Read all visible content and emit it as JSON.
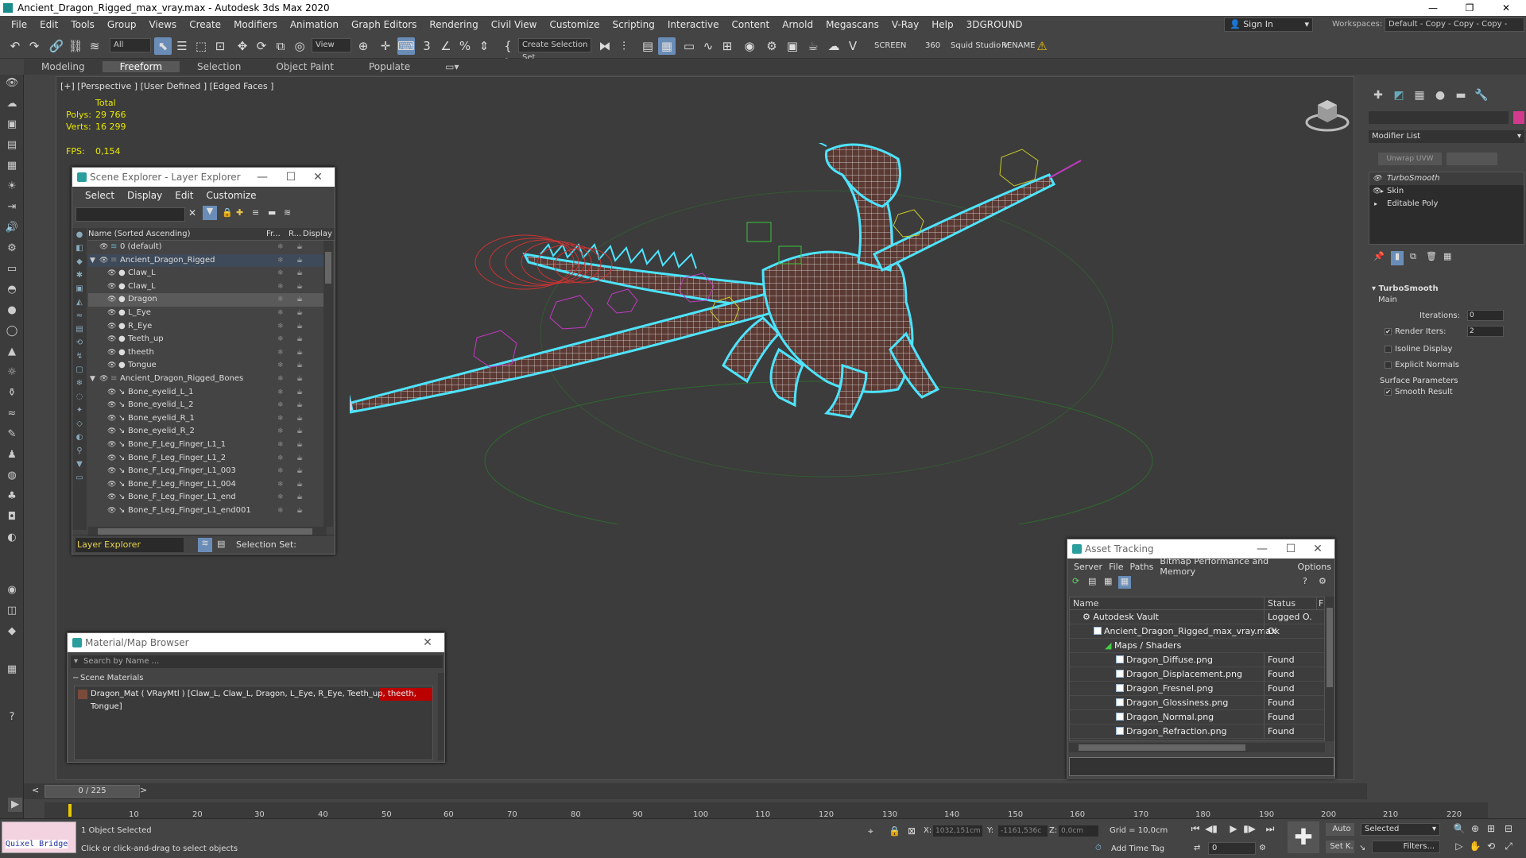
{
  "window": {
    "title": "Ancient_Dragon_Rigged_max_vray.max - Autodesk 3ds Max 2020"
  },
  "menu": [
    "File",
    "Edit",
    "Tools",
    "Group",
    "Views",
    "Create",
    "Modifiers",
    "Animation",
    "Graph Editors",
    "Rendering",
    "Civil View",
    "Customize",
    "Scripting",
    "Interactive",
    "Content",
    "Arnold",
    "Megascans",
    "V-Ray",
    "Help",
    "3DGROUND"
  ],
  "account": {
    "signin": "Sign In",
    "workspaces_label": "Workspaces:",
    "workspace": "Default - Copy - Copy - Copy - Copy"
  },
  "toolbar": {
    "filter": "All",
    "ref_coord": "View",
    "selection_set": "Create Selection Set",
    "screen": "SCREEN",
    "angle": "360",
    "squid": "Squid Studio v",
    "rename": "RENAME"
  },
  "ribbon": [
    "Modeling",
    "Freeform",
    "Selection",
    "Object Paint",
    "Populate"
  ],
  "viewport": {
    "label": "[+] [Perspective ] [User Defined ] [Edged Faces ]",
    "total": "Total",
    "polys_label": "Polys:",
    "polys": "29 766",
    "verts_label": "Verts:",
    "verts": "16 299",
    "fps_label": "FPS:",
    "fps": "0,154"
  },
  "scene_explorer": {
    "title": "Scene Explorer - Layer Explorer",
    "menu": [
      "Select",
      "Display",
      "Edit",
      "Customize"
    ],
    "columns": {
      "name": "Name (Sorted Ascending)",
      "frozen": "Fr...",
      "render": "R...",
      "display": "Display as B"
    },
    "rows": [
      {
        "name": "0 (default)",
        "indent": 1
      },
      {
        "name": "Ancient_Dragon_Rigged",
        "indent": 1
      },
      {
        "name": "Claw_L",
        "indent": 2
      },
      {
        "name": "Claw_L",
        "indent": 2
      },
      {
        "name": "Dragon",
        "indent": 2
      },
      {
        "name": "L_Eye",
        "indent": 2
      },
      {
        "name": "R_Eye",
        "indent": 2
      },
      {
        "name": "Teeth_up",
        "indent": 2
      },
      {
        "name": "theeth",
        "indent": 2
      },
      {
        "name": "Tongue",
        "indent": 2
      },
      {
        "name": "Ancient_Dragon_Rigged_Bones",
        "indent": 1
      },
      {
        "name": "Bone_eyelid_L_1",
        "indent": 2
      },
      {
        "name": "Bone_eyelid_L_2",
        "indent": 2
      },
      {
        "name": "Bone_eyelid_R_1",
        "indent": 2
      },
      {
        "name": "Bone_eyelid_R_2",
        "indent": 2
      },
      {
        "name": "Bone_F_Leg_Finger_L1_1",
        "indent": 2
      },
      {
        "name": "Bone_F_Leg_Finger_L1_2",
        "indent": 2
      },
      {
        "name": "Bone_F_Leg_Finger_L1_003",
        "indent": 2
      },
      {
        "name": "Bone_F_Leg_Finger_L1_004",
        "indent": 2
      },
      {
        "name": "Bone_F_Leg_Finger_L1_end",
        "indent": 2
      },
      {
        "name": "Bone_F_Leg_Finger_L1_end001",
        "indent": 2
      }
    ],
    "footer": {
      "explorer": "Layer Explorer",
      "selection_set": "Selection Set:"
    }
  },
  "material_browser": {
    "title": "Material/Map Browser",
    "search_placeholder": "Search by Name ...",
    "section": "Scene Materials",
    "item": "Dragon_Mat  ( VRayMtl )  [Claw_L, Claw_L, Dragon, L_Eye, R_Eye, Teeth_up, theeth, Tongue]"
  },
  "asset_tracking": {
    "title": "Asset Tracking",
    "menu": [
      "Server",
      "File",
      "Paths",
      "Bitmap Performance and Memory",
      "Options"
    ],
    "columns": {
      "name": "Name",
      "status": "Status",
      "extra": "F"
    },
    "rows": [
      {
        "name": "Autodesk Vault",
        "status": "Logged O...",
        "indent": 1
      },
      {
        "name": "Ancient_Dragon_Rigged_max_vray.max",
        "status": "Ok",
        "indent": 2
      },
      {
        "name": "Maps / Shaders",
        "status": "",
        "indent": 3
      },
      {
        "name": "Dragon_Diffuse.png",
        "status": "Found",
        "indent": 4
      },
      {
        "name": "Dragon_Displacement.png",
        "status": "Found",
        "indent": 4
      },
      {
        "name": "Dragon_Fresnel.png",
        "status": "Found",
        "indent": 4
      },
      {
        "name": "Dragon_Glossiness.png",
        "status": "Found",
        "indent": 4
      },
      {
        "name": "Dragon_Normal.png",
        "status": "Found",
        "indent": 4
      },
      {
        "name": "Dragon_Refraction.png",
        "status": "Found",
        "indent": 4
      }
    ]
  },
  "command_panel": {
    "modifier_list": "Modifier List",
    "unwrap": "Unwrap UVW",
    "stack": [
      "TurboSmooth",
      "Skin",
      "Editable Poly"
    ],
    "turbosmooth": {
      "title": "TurboSmooth",
      "main": "Main",
      "iterations_label": "Iterations:",
      "iterations": "0",
      "render_iters_label": "Render Iters:",
      "render_iters": "2",
      "isoline": "Isoline Display",
      "explicit": "Explicit Normals",
      "surface": "Surface Parameters",
      "smooth": "Smooth Result"
    }
  },
  "timeline": {
    "frame": "0 / 225",
    "ticks": [
      "10",
      "20",
      "30",
      "40",
      "50",
      "60",
      "70",
      "80",
      "90",
      "100",
      "110",
      "120",
      "130",
      "140",
      "150",
      "160",
      "170",
      "180",
      "190",
      "200",
      "210",
      "220"
    ]
  },
  "status": {
    "quixel": "Quixel Bridge",
    "selected": "1 Object Selected",
    "prompt": "Click or click-and-drag to select objects",
    "x_label": "X:",
    "x": "1032,151cm",
    "y_label": "Y:",
    "y": "-1161,536c",
    "z_label": "Z:",
    "z": "0,0cm",
    "grid": "Grid = 10,0cm",
    "add_time_tag": "Add Time Tag",
    "auto": "Auto",
    "set_key": "Set K.",
    "key_mode": "Selected",
    "filters": "Filters...",
    "frame_field": "0"
  }
}
